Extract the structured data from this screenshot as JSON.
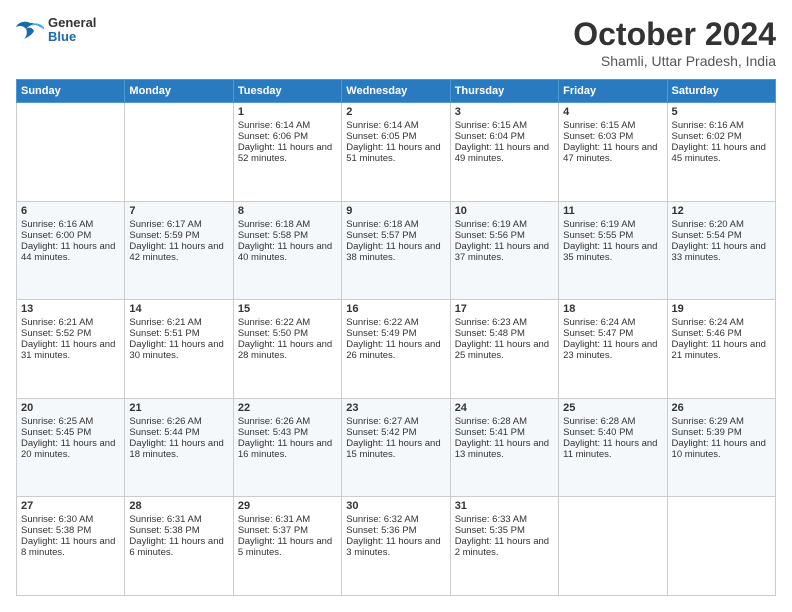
{
  "header": {
    "logo_general": "General",
    "logo_blue": "Blue",
    "month_title": "October 2024",
    "location": "Shamli, Uttar Pradesh, India"
  },
  "weekdays": [
    "Sunday",
    "Monday",
    "Tuesday",
    "Wednesday",
    "Thursday",
    "Friday",
    "Saturday"
  ],
  "weeks": [
    [
      {
        "day": "",
        "sunrise": "",
        "sunset": "",
        "daylight": ""
      },
      {
        "day": "",
        "sunrise": "",
        "sunset": "",
        "daylight": ""
      },
      {
        "day": "1",
        "sunrise": "Sunrise: 6:14 AM",
        "sunset": "Sunset: 6:06 PM",
        "daylight": "Daylight: 11 hours and 52 minutes."
      },
      {
        "day": "2",
        "sunrise": "Sunrise: 6:14 AM",
        "sunset": "Sunset: 6:05 PM",
        "daylight": "Daylight: 11 hours and 51 minutes."
      },
      {
        "day": "3",
        "sunrise": "Sunrise: 6:15 AM",
        "sunset": "Sunset: 6:04 PM",
        "daylight": "Daylight: 11 hours and 49 minutes."
      },
      {
        "day": "4",
        "sunrise": "Sunrise: 6:15 AM",
        "sunset": "Sunset: 6:03 PM",
        "daylight": "Daylight: 11 hours and 47 minutes."
      },
      {
        "day": "5",
        "sunrise": "Sunrise: 6:16 AM",
        "sunset": "Sunset: 6:02 PM",
        "daylight": "Daylight: 11 hours and 45 minutes."
      }
    ],
    [
      {
        "day": "6",
        "sunrise": "Sunrise: 6:16 AM",
        "sunset": "Sunset: 6:00 PM",
        "daylight": "Daylight: 11 hours and 44 minutes."
      },
      {
        "day": "7",
        "sunrise": "Sunrise: 6:17 AM",
        "sunset": "Sunset: 5:59 PM",
        "daylight": "Daylight: 11 hours and 42 minutes."
      },
      {
        "day": "8",
        "sunrise": "Sunrise: 6:18 AM",
        "sunset": "Sunset: 5:58 PM",
        "daylight": "Daylight: 11 hours and 40 minutes."
      },
      {
        "day": "9",
        "sunrise": "Sunrise: 6:18 AM",
        "sunset": "Sunset: 5:57 PM",
        "daylight": "Daylight: 11 hours and 38 minutes."
      },
      {
        "day": "10",
        "sunrise": "Sunrise: 6:19 AM",
        "sunset": "Sunset: 5:56 PM",
        "daylight": "Daylight: 11 hours and 37 minutes."
      },
      {
        "day": "11",
        "sunrise": "Sunrise: 6:19 AM",
        "sunset": "Sunset: 5:55 PM",
        "daylight": "Daylight: 11 hours and 35 minutes."
      },
      {
        "day": "12",
        "sunrise": "Sunrise: 6:20 AM",
        "sunset": "Sunset: 5:54 PM",
        "daylight": "Daylight: 11 hours and 33 minutes."
      }
    ],
    [
      {
        "day": "13",
        "sunrise": "Sunrise: 6:21 AM",
        "sunset": "Sunset: 5:52 PM",
        "daylight": "Daylight: 11 hours and 31 minutes."
      },
      {
        "day": "14",
        "sunrise": "Sunrise: 6:21 AM",
        "sunset": "Sunset: 5:51 PM",
        "daylight": "Daylight: 11 hours and 30 minutes."
      },
      {
        "day": "15",
        "sunrise": "Sunrise: 6:22 AM",
        "sunset": "Sunset: 5:50 PM",
        "daylight": "Daylight: 11 hours and 28 minutes."
      },
      {
        "day": "16",
        "sunrise": "Sunrise: 6:22 AM",
        "sunset": "Sunset: 5:49 PM",
        "daylight": "Daylight: 11 hours and 26 minutes."
      },
      {
        "day": "17",
        "sunrise": "Sunrise: 6:23 AM",
        "sunset": "Sunset: 5:48 PM",
        "daylight": "Daylight: 11 hours and 25 minutes."
      },
      {
        "day": "18",
        "sunrise": "Sunrise: 6:24 AM",
        "sunset": "Sunset: 5:47 PM",
        "daylight": "Daylight: 11 hours and 23 minutes."
      },
      {
        "day": "19",
        "sunrise": "Sunrise: 6:24 AM",
        "sunset": "Sunset: 5:46 PM",
        "daylight": "Daylight: 11 hours and 21 minutes."
      }
    ],
    [
      {
        "day": "20",
        "sunrise": "Sunrise: 6:25 AM",
        "sunset": "Sunset: 5:45 PM",
        "daylight": "Daylight: 11 hours and 20 minutes."
      },
      {
        "day": "21",
        "sunrise": "Sunrise: 6:26 AM",
        "sunset": "Sunset: 5:44 PM",
        "daylight": "Daylight: 11 hours and 18 minutes."
      },
      {
        "day": "22",
        "sunrise": "Sunrise: 6:26 AM",
        "sunset": "Sunset: 5:43 PM",
        "daylight": "Daylight: 11 hours and 16 minutes."
      },
      {
        "day": "23",
        "sunrise": "Sunrise: 6:27 AM",
        "sunset": "Sunset: 5:42 PM",
        "daylight": "Daylight: 11 hours and 15 minutes."
      },
      {
        "day": "24",
        "sunrise": "Sunrise: 6:28 AM",
        "sunset": "Sunset: 5:41 PM",
        "daylight": "Daylight: 11 hours and 13 minutes."
      },
      {
        "day": "25",
        "sunrise": "Sunrise: 6:28 AM",
        "sunset": "Sunset: 5:40 PM",
        "daylight": "Daylight: 11 hours and 11 minutes."
      },
      {
        "day": "26",
        "sunrise": "Sunrise: 6:29 AM",
        "sunset": "Sunset: 5:39 PM",
        "daylight": "Daylight: 11 hours and 10 minutes."
      }
    ],
    [
      {
        "day": "27",
        "sunrise": "Sunrise: 6:30 AM",
        "sunset": "Sunset: 5:38 PM",
        "daylight": "Daylight: 11 hours and 8 minutes."
      },
      {
        "day": "28",
        "sunrise": "Sunrise: 6:31 AM",
        "sunset": "Sunset: 5:38 PM",
        "daylight": "Daylight: 11 hours and 6 minutes."
      },
      {
        "day": "29",
        "sunrise": "Sunrise: 6:31 AM",
        "sunset": "Sunset: 5:37 PM",
        "daylight": "Daylight: 11 hours and 5 minutes."
      },
      {
        "day": "30",
        "sunrise": "Sunrise: 6:32 AM",
        "sunset": "Sunset: 5:36 PM",
        "daylight": "Daylight: 11 hours and 3 minutes."
      },
      {
        "day": "31",
        "sunrise": "Sunrise: 6:33 AM",
        "sunset": "Sunset: 5:35 PM",
        "daylight": "Daylight: 11 hours and 2 minutes."
      },
      {
        "day": "",
        "sunrise": "",
        "sunset": "",
        "daylight": ""
      },
      {
        "day": "",
        "sunrise": "",
        "sunset": "",
        "daylight": ""
      }
    ]
  ]
}
